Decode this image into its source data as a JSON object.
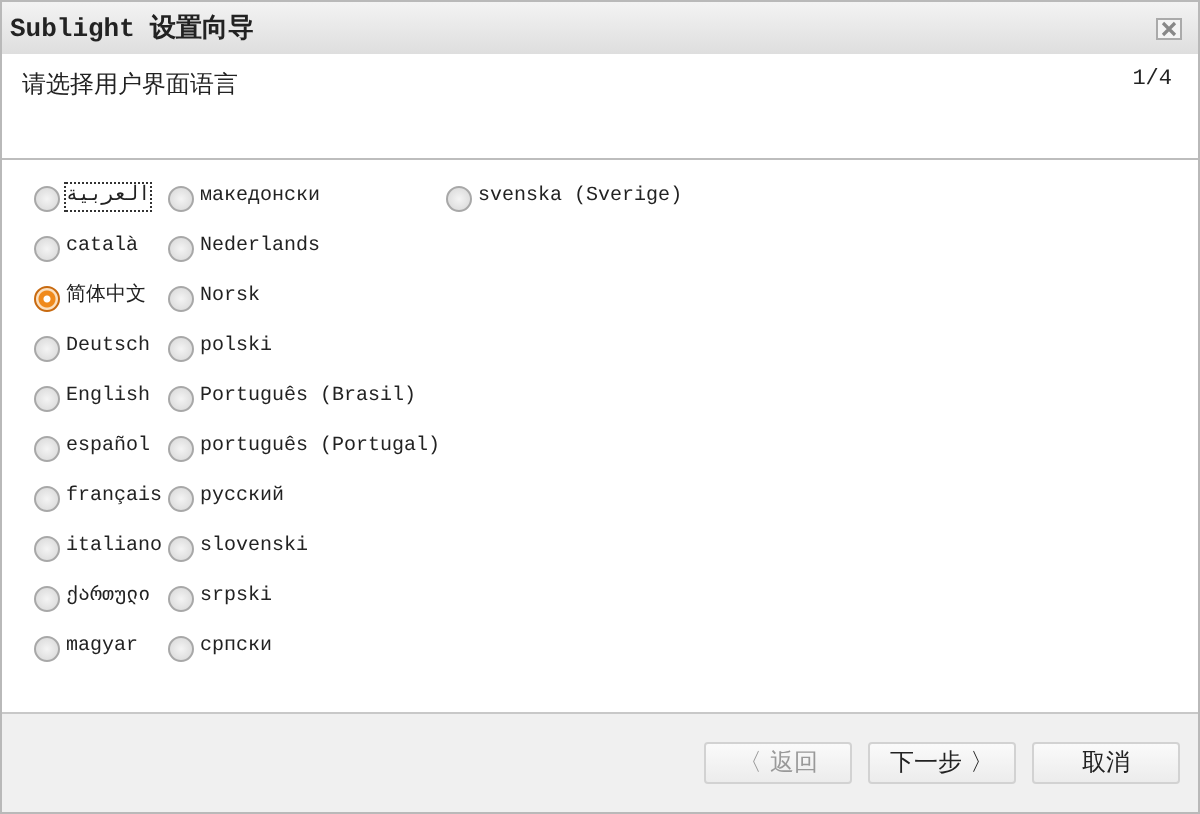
{
  "window": {
    "title": "Sublight 设置向导"
  },
  "header": {
    "instruction": "请选择用户界面语言",
    "step": "1/4"
  },
  "languages": [
    {
      "label": "العربية",
      "selected": false,
      "focused": true
    },
    {
      "label": "català",
      "selected": false,
      "focused": false
    },
    {
      "label": "简体中文",
      "selected": true,
      "focused": false
    },
    {
      "label": "Deutsch",
      "selected": false,
      "focused": false
    },
    {
      "label": "English",
      "selected": false,
      "focused": false
    },
    {
      "label": "español",
      "selected": false,
      "focused": false
    },
    {
      "label": "français",
      "selected": false,
      "focused": false
    },
    {
      "label": "italiano",
      "selected": false,
      "focused": false
    },
    {
      "label": "ქართული",
      "selected": false,
      "focused": false
    },
    {
      "label": "magyar",
      "selected": false,
      "focused": false
    },
    {
      "label": "македонски",
      "selected": false,
      "focused": false
    },
    {
      "label": "Nederlands",
      "selected": false,
      "focused": false
    },
    {
      "label": "Norsk",
      "selected": false,
      "focused": false
    },
    {
      "label": "polski",
      "selected": false,
      "focused": false
    },
    {
      "label": "Português (Brasil)",
      "selected": false,
      "focused": false
    },
    {
      "label": "português (Portugal)",
      "selected": false,
      "focused": false
    },
    {
      "label": "русский",
      "selected": false,
      "focused": false
    },
    {
      "label": "slovenski",
      "selected": false,
      "focused": false
    },
    {
      "label": "srpski",
      "selected": false,
      "focused": false
    },
    {
      "label": "српски",
      "selected": false,
      "focused": false
    },
    {
      "label": "svenska (Sverige)",
      "selected": false,
      "focused": false
    }
  ],
  "buttons": [
    {
      "label": "〈 返回",
      "disabled": true
    },
    {
      "label": "下一步 〉",
      "disabled": false
    },
    {
      "label": "取消",
      "disabled": false
    }
  ]
}
